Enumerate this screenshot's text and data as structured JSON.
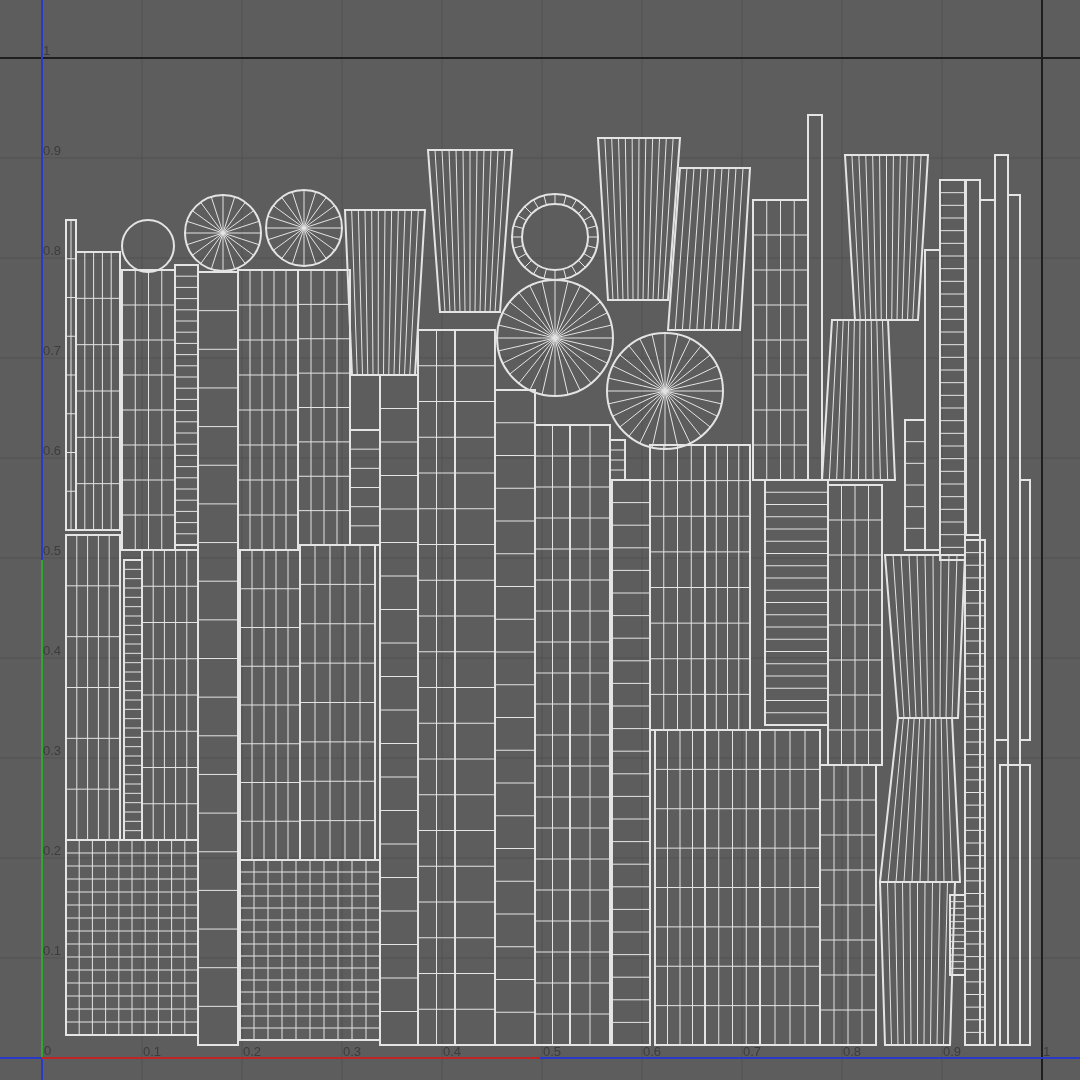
{
  "uv_editor": {
    "origin_label": "0",
    "v_axis_labels": [
      "1",
      "0.9",
      "0.8",
      "0.7",
      "0.6",
      "0.5",
      "0.4",
      "0.3",
      "0.2",
      "0.1"
    ],
    "u_axis_labels": [
      "0.1",
      "0.2",
      "0.3",
      "0.4",
      "0.5",
      "0.6",
      "0.7",
      "0.8",
      "0.9",
      "1"
    ]
  }
}
